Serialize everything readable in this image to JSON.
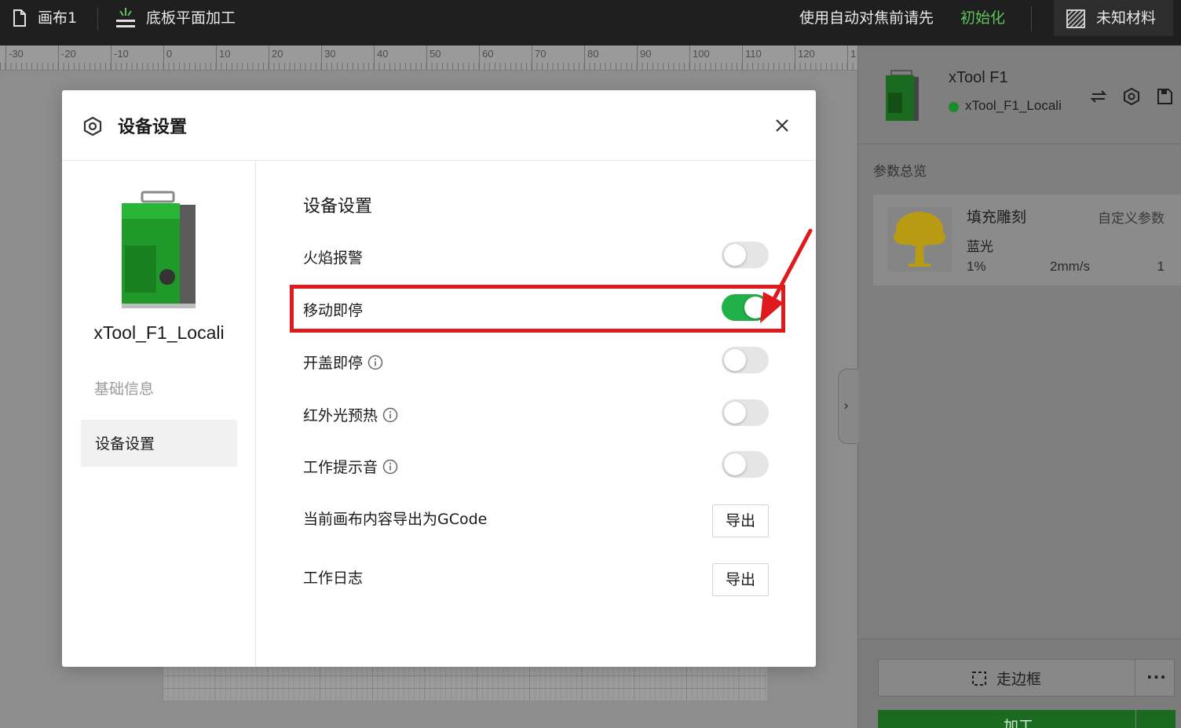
{
  "topbar": {
    "canvas_name": "画布1",
    "mode": "底板平面加工",
    "hint": "使用自动对焦前请先",
    "init_link": "初始化",
    "material": "未知材料"
  },
  "ruler": {
    "labels": [
      "-30",
      "-20",
      "-10",
      "0",
      "10",
      "20",
      "30",
      "40",
      "50",
      "60",
      "70",
      "80",
      "90",
      "100",
      "110",
      "120",
      "1"
    ]
  },
  "right_panel": {
    "device_title": "xTool F1",
    "device_status": "xTool_F1_Locali",
    "status_color": "#1b8c2b",
    "section_title": "参数总览",
    "card": {
      "title": "填充雕刻",
      "custom": "自定义参数",
      "light": "蓝光",
      "power": "1%",
      "speed": "2mm/s",
      "passes": "1"
    },
    "frame_button": "走边框",
    "more_button": "···",
    "process_button": "加工"
  },
  "modal": {
    "title": "设备设置",
    "sidebar": {
      "device_name": "xTool_F1_Locali",
      "item_basic": "基础信息",
      "item_settings": "设备设置"
    },
    "content": {
      "title": "设备设置",
      "settings": {
        "flame_alarm": {
          "label": "火焰报警",
          "on": false
        },
        "move_stop": {
          "label": "移动即停",
          "on": true
        },
        "lid_stop": {
          "label": "开盖即停",
          "on": false
        },
        "ir_preheat": {
          "label": "红外光预热",
          "on": false
        },
        "work_sound": {
          "label": "工作提示音",
          "on": false
        }
      },
      "export_gcode_label": "当前画布内容导出为GCode",
      "export_gcode_button": "导出",
      "work_log_label": "工作日志",
      "work_log_button": "导出"
    }
  },
  "colors": {
    "accent_green": "#21b04a",
    "highlight_red": "#e0191c",
    "init_green": "#5ec55b"
  }
}
